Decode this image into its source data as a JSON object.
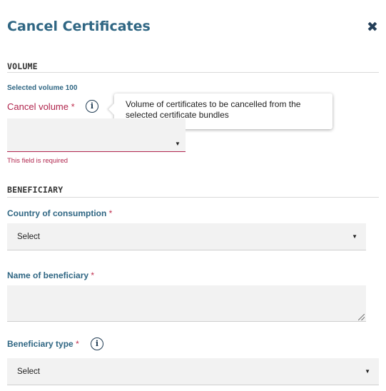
{
  "dialog": {
    "title": "Cancel Certificates",
    "close_icon": "close-icon",
    "close_glyph": "✖"
  },
  "volume": {
    "heading": "VOLUME",
    "selected_volume_text": "Selected volume 100",
    "cancel_label": "Cancel volume",
    "required_marker": "*",
    "info_icon": "info-icon",
    "info_glyph": "i",
    "tooltip_text": "Volume of certificates to be cancelled from the selected certificate bundles",
    "input_value": "",
    "caret_glyph": "▼",
    "error_text": "This field is required"
  },
  "beneficiary": {
    "heading": "BENEFICIARY",
    "country_label": "Country of consumption",
    "country_value": "Select",
    "name_label": "Name of beneficiary",
    "name_value": "",
    "type_label": "Beneficiary type",
    "type_value": "Select",
    "required_marker": "*",
    "caret_glyph": "▼",
    "info_glyph": "i"
  },
  "colors": {
    "title": "#2f6683",
    "label": "#2f6683",
    "error": "#b0254d",
    "field_bg": "#f2f2f2"
  }
}
